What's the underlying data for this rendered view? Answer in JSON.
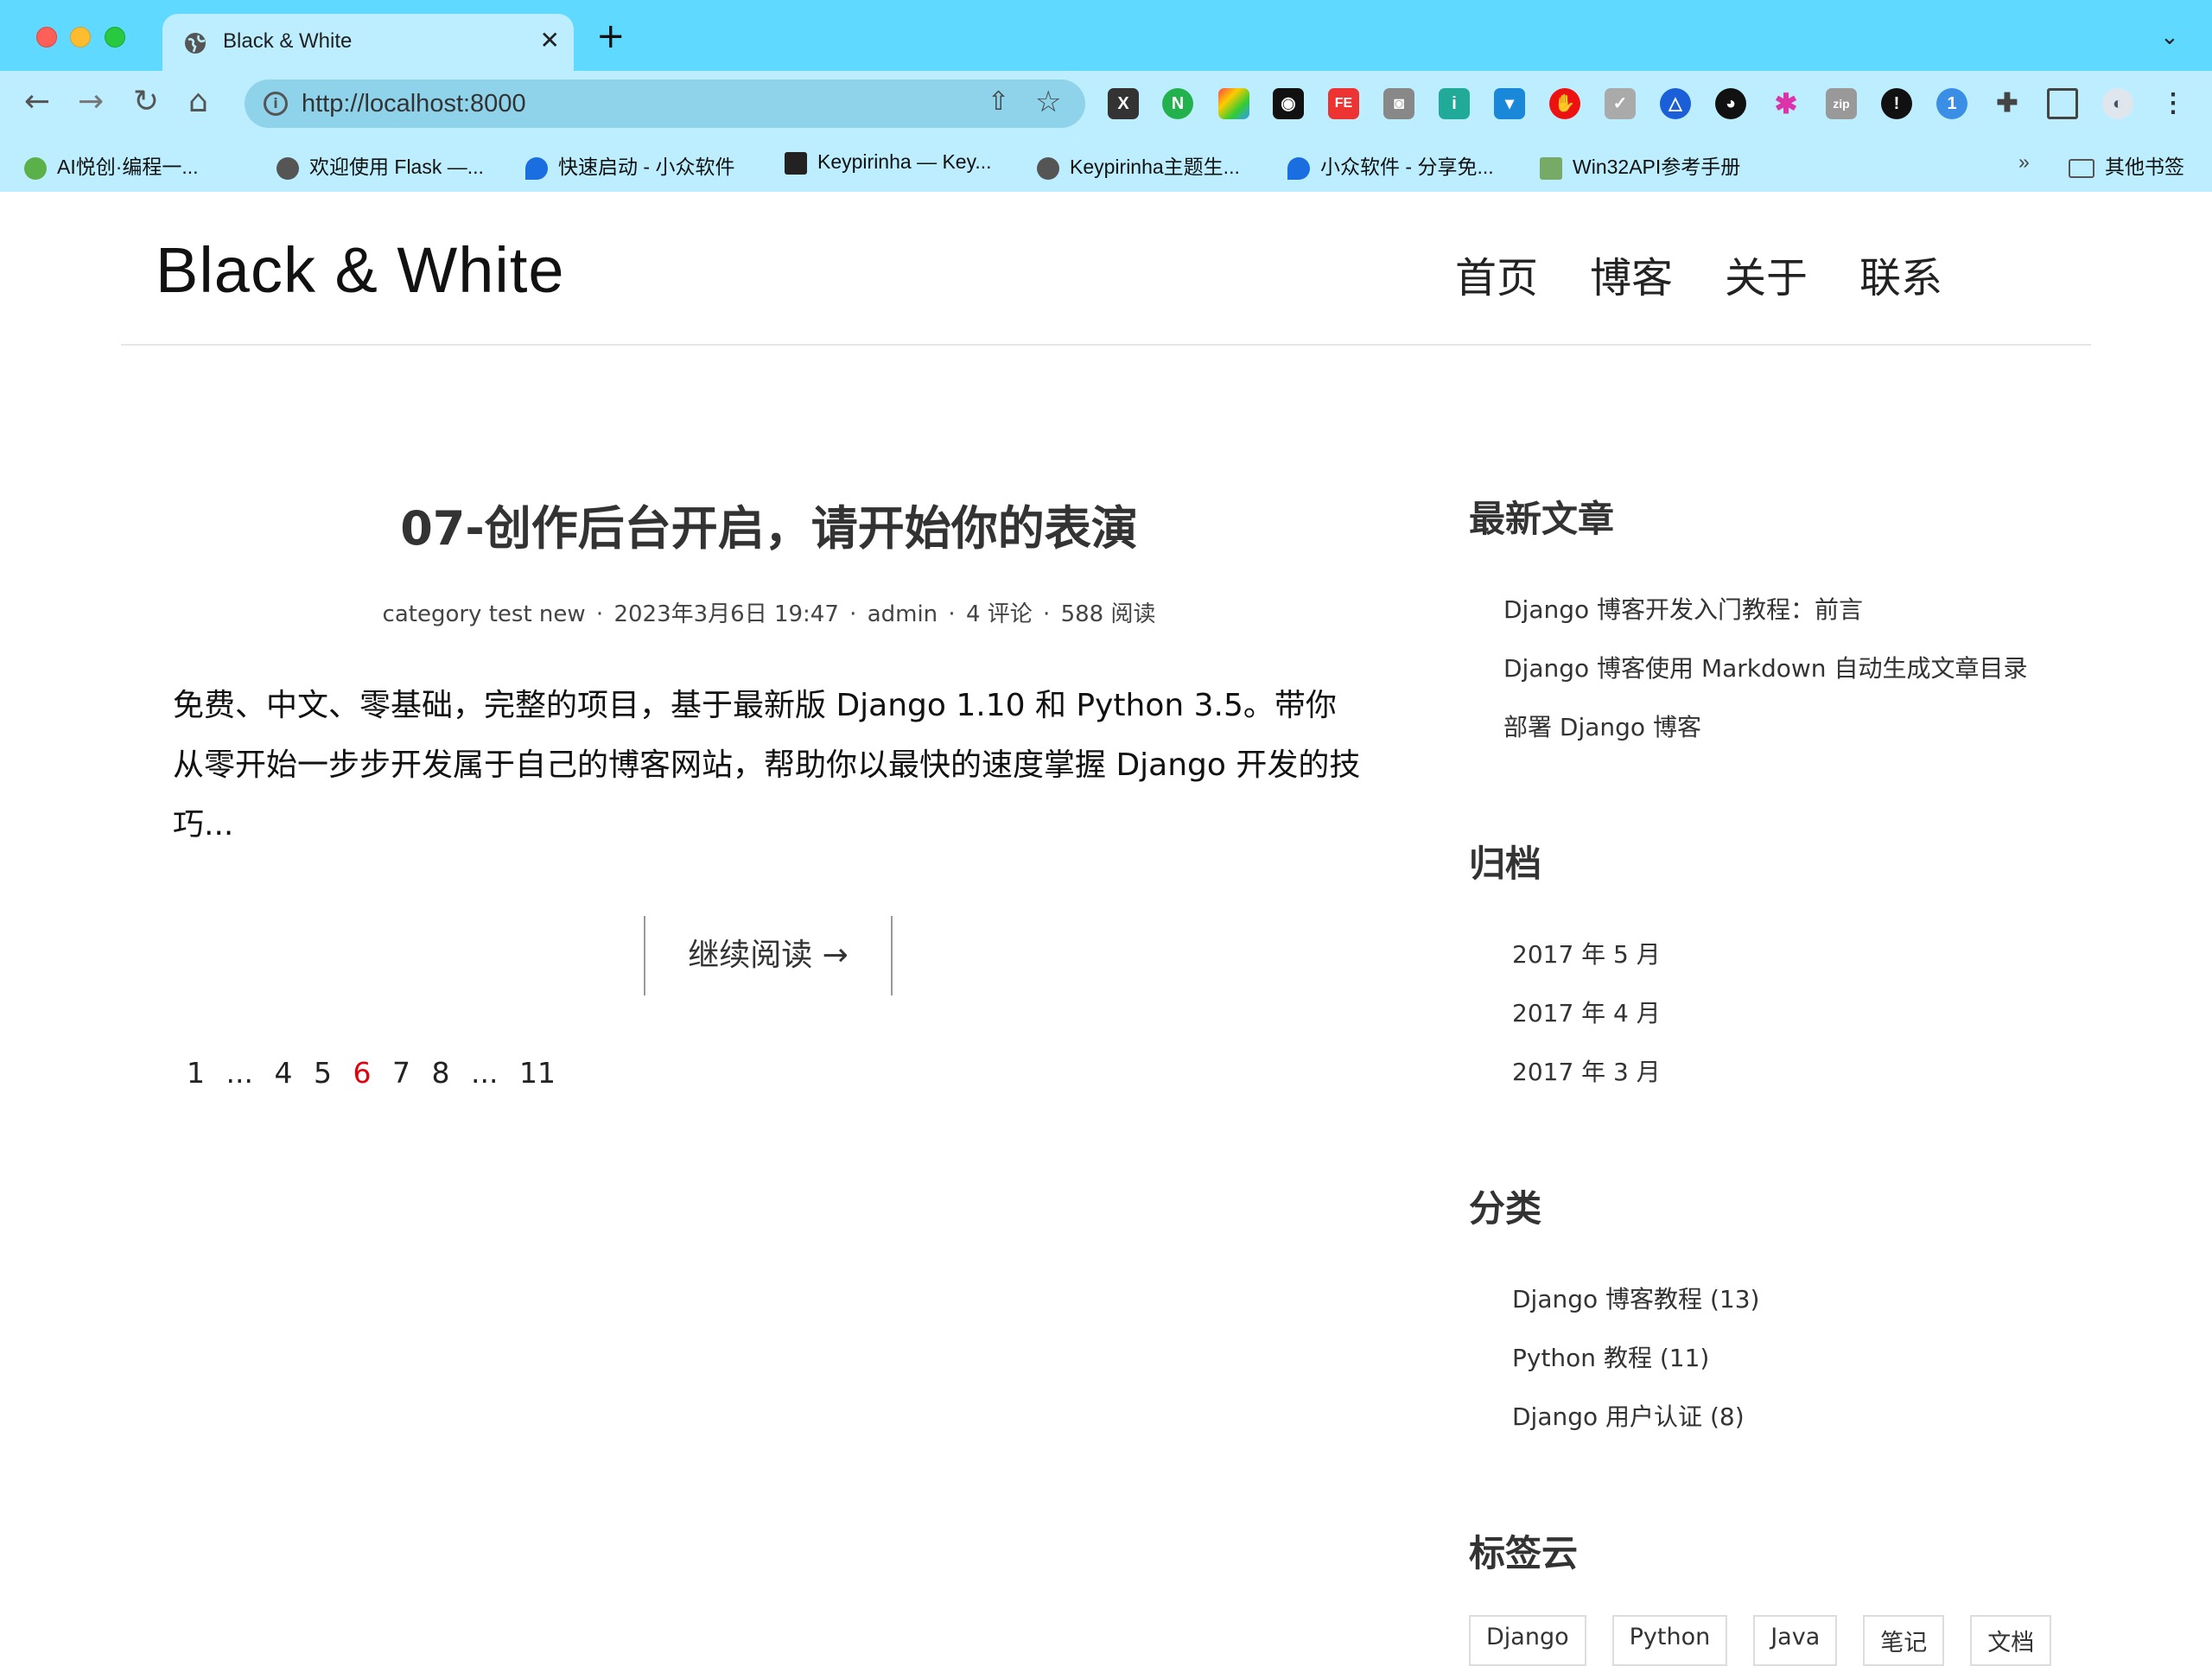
{
  "browser": {
    "tab_title": "Black & White",
    "new_tab_label": "+",
    "tab_menu_label": "⌄",
    "url": "http://localhost:8000",
    "bookmarks": [
      "AI悦创·编程一...",
      "欢迎使用 Flask —...",
      "快速启动 - 小众软件",
      "Keypirinha — Key...",
      "Keypirinha主题生...",
      "小众软件 - 分享免...",
      "Win32API参考手册"
    ],
    "bookmarks_more": "»",
    "other_bookmarks": "其他书签",
    "colors": {
      "frame": "#5fd9ff",
      "toolbar": "#bdeeff",
      "omnibox": "#8fd3ea"
    }
  },
  "site": {
    "logo_main": "Black",
    "logo_rest": "& White",
    "nav": [
      "首页",
      "博客",
      "关于",
      "联系"
    ]
  },
  "post": {
    "title": "07-创作后台开启，请开始你的表演",
    "category": "category test new",
    "date": "2023年3月6日 19:47",
    "author": "admin",
    "comments": "4 评论",
    "views": "588 阅读",
    "separator": "·",
    "excerpt": "免费、中文、零基础，完整的项目，基于最新版 Django 1.10 和 Python 3.5。带你从零开始一步步开发属于自己的博客网站，帮助你以最快的速度掌握 Django 开发的技巧...",
    "read_more": "继续阅读 →"
  },
  "pagination": {
    "items": [
      "1",
      "...",
      "4",
      "5",
      "6",
      "7",
      "8",
      "...",
      "11"
    ],
    "current": "6",
    "current_color": "#e3000d"
  },
  "sidebar": {
    "recent_title": "最新文章",
    "recent": [
      "Django 博客开发入门教程：前言",
      "Django 博客使用 Markdown 自动生成文章目录",
      "部署 Django 博客"
    ],
    "archive_title": "归档",
    "archive": [
      "2017 年 5 月",
      "2017 年 4 月",
      "2017 年 3 月"
    ],
    "categories_title": "分类",
    "categories": [
      "Django 博客教程 (13)",
      "Python 教程 (11)",
      "Django 用户认证 (8)"
    ],
    "tags_title": "标签云",
    "tags": [
      "Django",
      "Python",
      "Java",
      "笔记",
      "文档"
    ]
  }
}
